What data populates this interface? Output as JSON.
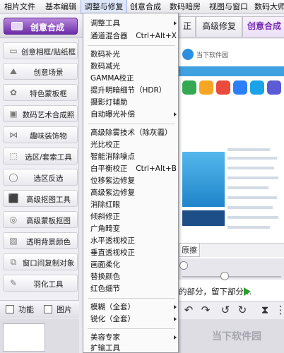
{
  "menubar": {
    "items": [
      "相片文件",
      "基本编辑",
      "调整与修复",
      "创意合成",
      "数码暗房",
      "视图与窗口",
      "数码大师"
    ],
    "active_index": 2
  },
  "toolbar": {
    "creative_button": "创意合成",
    "tabs": [
      "正",
      "高级修复",
      "创意合成"
    ],
    "selected_tab_index": 2
  },
  "left_panel": {
    "items": [
      {
        "label": "创意相框/贴纸框",
        "icon": "frame-icon"
      },
      {
        "label": "创意场景",
        "icon": "scene-icon"
      },
      {
        "label": "特色蒙板框",
        "icon": "flower-icon"
      },
      {
        "label": "数码艺术合成照",
        "icon": "portrait-icon"
      },
      {
        "label": "趣味装饰物",
        "icon": "bow-icon"
      },
      {
        "label": "选区/套索工具",
        "icon": "lasso-icon"
      },
      {
        "label": "选区反选",
        "icon": "invert-selection-icon"
      },
      {
        "label": "高级抠图工具",
        "icon": "cutout-icon"
      },
      {
        "label": "高级蒙板抠图",
        "icon": "mask-icon"
      },
      {
        "label": "透明背景颜色",
        "icon": "transparency-icon"
      },
      {
        "label": "窗口间复制对象",
        "icon": "copy-window-icon"
      },
      {
        "label": "羽化工具",
        "icon": "feather-icon"
      }
    ],
    "bottom_tabs": [
      "功能",
      "图片"
    ]
  },
  "dropdown": {
    "sections": [
      [
        {
          "label": "调整工具",
          "arrow": true
        },
        {
          "label": "通道混合器",
          "shortcut": "Ctrl+Alt+X"
        }
      ],
      [
        {
          "label": "数码补光"
        },
        {
          "label": "数码减光"
        },
        {
          "label": "GAMMA校正"
        },
        {
          "label": "提升明暗细节（HDR）"
        },
        {
          "label": "摄影灯辅助"
        },
        {
          "label": "自动曝光补偿",
          "arrow": true
        }
      ],
      [
        {
          "label": "高级除雾技术（除灰霾）"
        },
        {
          "label": "光比校正"
        },
        {
          "label": "智能消除噪点"
        },
        {
          "label": "白平衡校正",
          "shortcut": "Ctrl+Alt+B"
        },
        {
          "label": "位移紫边修复"
        },
        {
          "label": "高级紫边修复"
        },
        {
          "label": "消除红眼"
        },
        {
          "label": "倾斜修正"
        },
        {
          "label": "广角畸变"
        },
        {
          "label": "水平透视校正"
        },
        {
          "label": "垂直透视校正"
        },
        {
          "label": "画面柔化"
        },
        {
          "label": "替换颜色"
        },
        {
          "label": "红色细节"
        }
      ],
      [
        {
          "label": "模糊（全套）",
          "arrow": true
        },
        {
          "label": "锐化（全套）",
          "arrow": true
        }
      ],
      [
        {
          "label": "美容专家",
          "arrow": true
        },
        {
          "label": "扩输工具"
        }
      ]
    ]
  },
  "main": {
    "site_name": "当下软件园",
    "restore_label": "原擦",
    "hint": "的部分，留下部分…",
    "watermark": "当下软件园"
  },
  "colors": {
    "accent_purple": "#7a2fb4",
    "site_blue": "#3fa1e0",
    "play_green": "#2aa02a"
  }
}
